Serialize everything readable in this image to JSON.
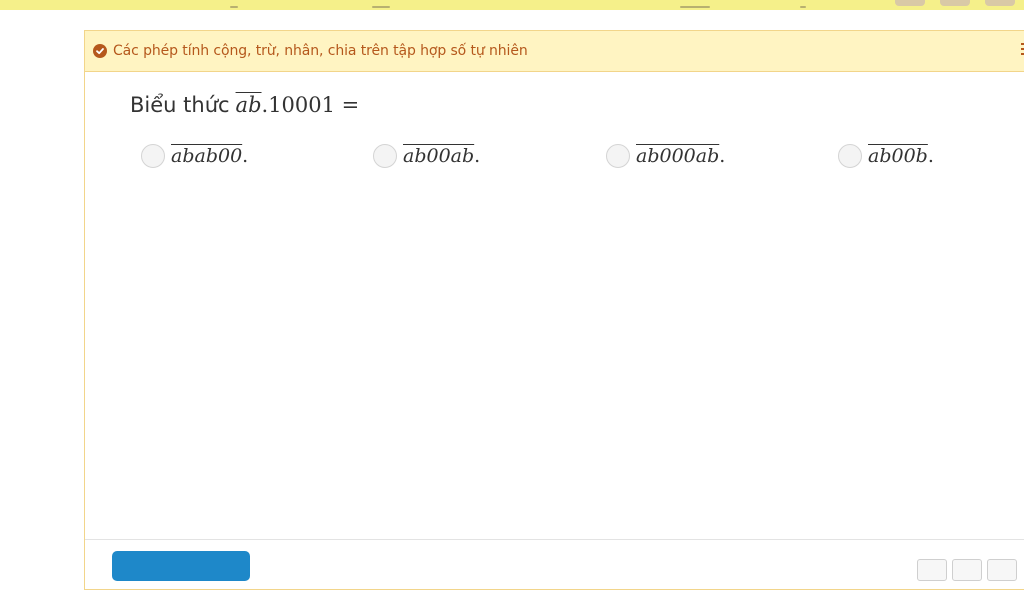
{
  "header": {
    "lesson_title": "Các phép tính cộng, trừ, nhân, chia trên tập hợp số tự nhiên"
  },
  "question": {
    "prompt": "Biểu thức",
    "expr_overline": "ab",
    "expr_rest": ".10001 ="
  },
  "options": [
    {
      "overline": "abab00",
      "suffix": "."
    },
    {
      "overline": "ab00ab",
      "suffix": "."
    },
    {
      "overline": "ab000ab",
      "suffix": "."
    },
    {
      "overline": "ab00b",
      "suffix": "."
    }
  ],
  "colors": {
    "header_bg": "#fff4c2",
    "accent": "#b5581c",
    "submit_button": "#1e88c9",
    "top_strip": "#f5f08a"
  },
  "icons": {
    "header_check": "check-circle-icon",
    "menu": "menu-icon"
  }
}
